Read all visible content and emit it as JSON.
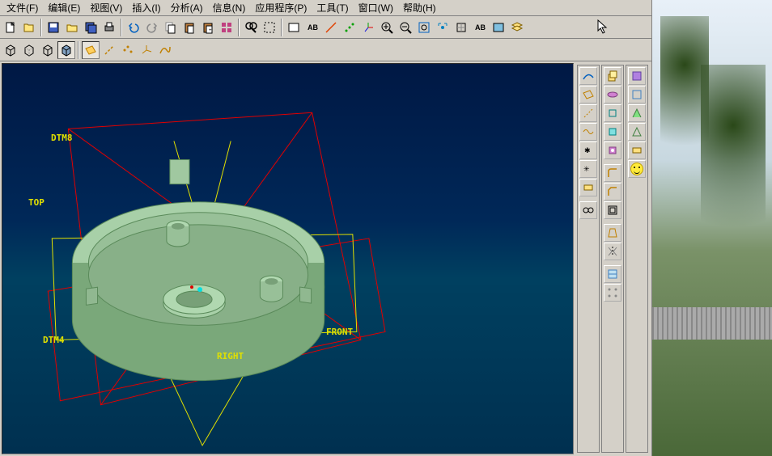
{
  "menu": {
    "file": "文件(F)",
    "edit": "编辑(E)",
    "view": "视图(V)",
    "insert": "插入(I)",
    "analysis": "分析(A)",
    "info": "信息(N)",
    "applications": "应用程序(P)",
    "tools": "工具(T)",
    "window": "窗口(W)",
    "help": "帮助(H)"
  },
  "datums": {
    "dtm8": "DTM8",
    "top": "TOP",
    "dtm4": "DTM4",
    "right": "RIGHT",
    "front": "FRONT"
  },
  "icons": {
    "new": "new",
    "open": "open",
    "save": "save",
    "print": "print",
    "undo": "undo",
    "redo": "redo",
    "copy": "copy",
    "paste": "paste",
    "find": "find",
    "zoom_in": "zoom-in",
    "zoom_out": "zoom-out",
    "zoom_window": "zoom-window",
    "refit": "refit",
    "repaint": "repaint",
    "wireframe": "wireframe",
    "hidden": "hidden",
    "nohidden": "nohidden",
    "shade": "shade",
    "datum_plane": "datum-plane",
    "datum_axis": "datum-axis",
    "datum_point": "datum-point",
    "datum_csys": "datum-csys"
  },
  "palette": {
    "col1": [
      "curve",
      "plane",
      "line",
      "spline",
      "point",
      "axis",
      "csys",
      "chain"
    ],
    "col2": [
      "extrude",
      "revolve",
      "sweep",
      "blend",
      "hole",
      "round",
      "chamfer",
      "shell",
      "rib",
      "draft",
      "pattern",
      "mirror",
      "copy",
      "cross-section"
    ],
    "col3": [
      "layer1",
      "layer2",
      "layer3",
      "hide",
      "show",
      "smiley"
    ]
  }
}
